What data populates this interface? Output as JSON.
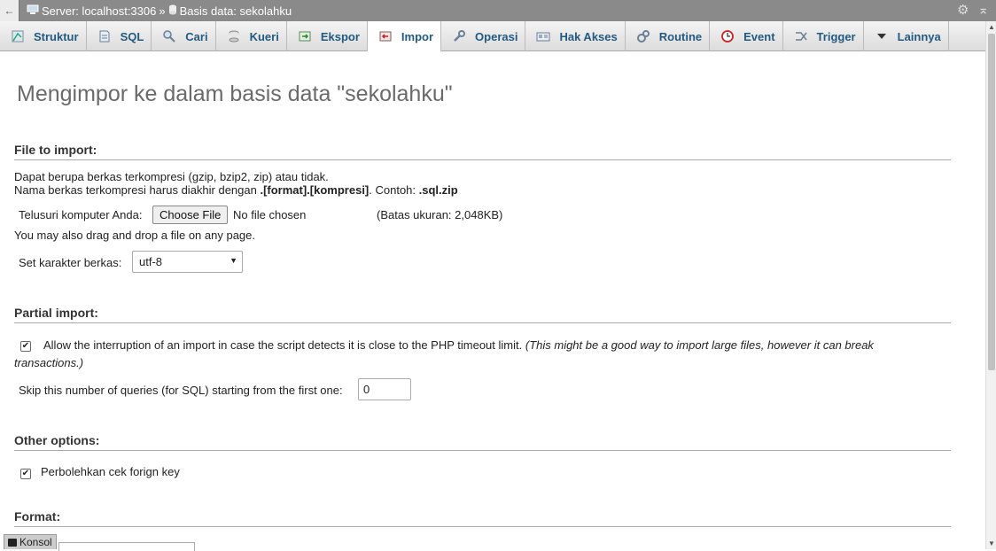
{
  "topbar": {
    "back_label": "←",
    "server_label": "Server: localhost:3306",
    "separator": "»",
    "database_label": "Basis data: sekolahku"
  },
  "tabs": [
    {
      "label": "Struktur",
      "icon": "structure-icon"
    },
    {
      "label": "SQL",
      "icon": "sql-icon"
    },
    {
      "label": "Cari",
      "icon": "search-icon"
    },
    {
      "label": "Kueri",
      "icon": "query-icon"
    },
    {
      "label": "Ekspor",
      "icon": "export-icon"
    },
    {
      "label": "Impor",
      "icon": "import-icon",
      "active": true
    },
    {
      "label": "Operasi",
      "icon": "wrench-icon"
    },
    {
      "label": "Hak Akses",
      "icon": "privileges-icon"
    },
    {
      "label": "Routine",
      "icon": "routine-icon"
    },
    {
      "label": "Event",
      "icon": "clock-icon"
    },
    {
      "label": "Trigger",
      "icon": "trigger-icon"
    },
    {
      "label": "Lainnya",
      "icon": "chevron-down-icon"
    }
  ],
  "page_title": "Mengimpor ke dalam basis data \"sekolahku\"",
  "file_section": {
    "legend": "File to import:",
    "desc_line1": "Dapat berupa berkas terkompresi (gzip, bzip2, zip) atau tidak.",
    "desc_line2_prefix": "Nama berkas terkompresi harus diakhir dengan ",
    "desc_line2_format": ".[format].[kompresi]",
    "desc_line2_mid": ". Contoh: ",
    "desc_line2_example": ".sql.zip",
    "browse_label": "Telusuri komputer Anda:",
    "choose_file_label": "Choose File",
    "no_file_label": "No file chosen",
    "size_limit": "(Batas ukuran: 2,048KB)",
    "drag_drop_note": "You may also drag and drop a file on any page.",
    "charset_label": "Set karakter berkas:",
    "charset_value": "utf-8"
  },
  "partial_section": {
    "legend": "Partial import:",
    "allow_interrupt_checked": true,
    "allow_interrupt_label": "Allow the interruption of an import in case the script detects it is close to the PHP timeout limit.",
    "allow_interrupt_note_a": "(This might be a good way to import large files, however it can break",
    "allow_interrupt_note_b": "transactions.)",
    "skip_label": "Skip this number of queries (for SQL) starting from the first one:",
    "skip_value": "0"
  },
  "other_section": {
    "legend": "Other options:",
    "foreign_key_checked": true,
    "foreign_key_label": "Perbolehkan cek forign key"
  },
  "format_section": {
    "legend": "Format:"
  },
  "konsol_label": "Konsol"
}
